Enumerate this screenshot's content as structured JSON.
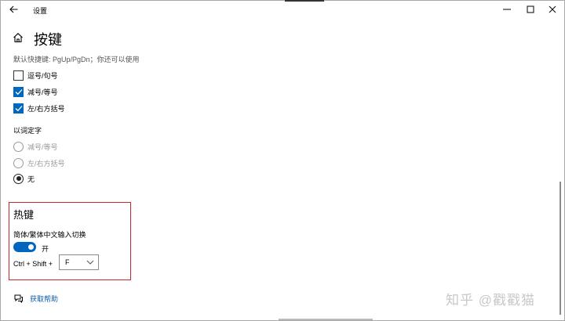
{
  "window": {
    "title": "设置",
    "controls": [
      "minimize-icon",
      "maximize-icon",
      "close-icon"
    ]
  },
  "page": {
    "title": "按键",
    "description": "默认快捷键: PgUp/PgDn；你还可以使用"
  },
  "shortcut_options": [
    {
      "label": "逗号/句号",
      "checked": false
    },
    {
      "label": "减号/等号",
      "checked": true
    },
    {
      "label": "左/右方括号",
      "checked": true
    }
  ],
  "fix_word": {
    "label": "以词定字",
    "options": [
      {
        "label": "减号/等号",
        "selected": false,
        "disabled": true
      },
      {
        "label": "左/右方括号",
        "selected": false,
        "disabled": true
      },
      {
        "label": "无",
        "selected": true,
        "disabled": false
      }
    ]
  },
  "hotkey": {
    "title": "热键",
    "subtitle": "简体/繁体中文输入切换",
    "toggle_label": "开",
    "toggle_on": true,
    "key_prefix": "Ctrl + Shift +",
    "key_value": "F"
  },
  "help": {
    "link_label": "获取帮助"
  },
  "watermark": "知乎 @戳戳猫",
  "colors": {
    "accent": "#0067c0",
    "highlight_box": "#d2232a",
    "link": "#0b5cad"
  }
}
